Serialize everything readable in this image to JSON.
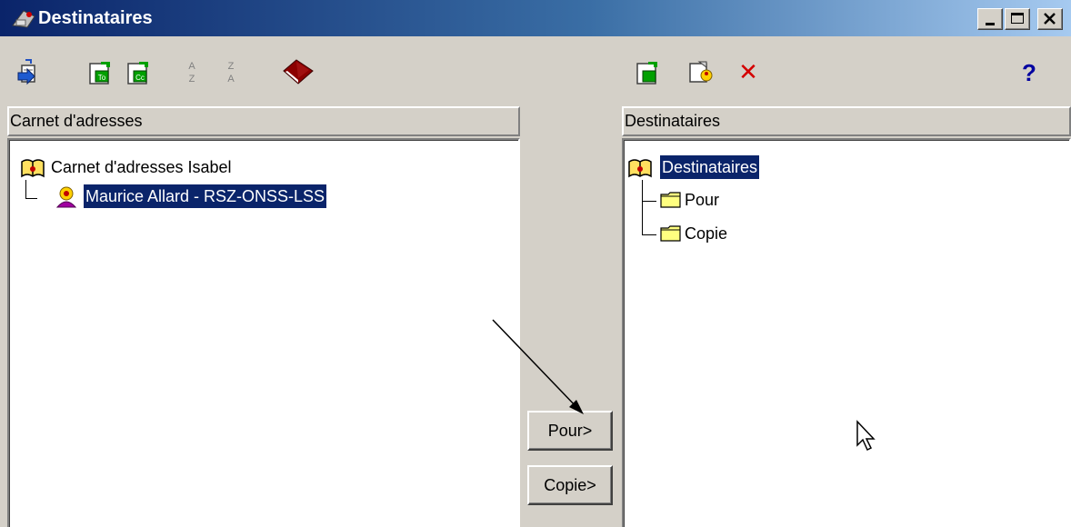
{
  "window": {
    "title": "Destinataires"
  },
  "colors": {
    "title_start": "#0a246a",
    "title_end": "#a6caf0",
    "selection": "#0a246a",
    "delete_red": "#d40000",
    "help_blue": "#0000a0"
  },
  "left_toolbar": {
    "icons": [
      "import-icon",
      "add-to-icon",
      "add-cc-icon",
      "sort-ascending-icon",
      "sort-descending-icon",
      "address-book-icon"
    ]
  },
  "right_toolbar": {
    "icons": [
      "add-recipient-icon",
      "properties-icon",
      "delete-icon",
      "help-icon"
    ],
    "help_glyph": "?",
    "delete_glyph": "✕"
  },
  "left_panel": {
    "header": "Carnet d'adresses",
    "root": "Carnet d'adresses Isabel",
    "children": [
      "Maurice Allard - RSZ-ONSS-LSS"
    ]
  },
  "right_panel": {
    "header": "Destinataires",
    "root": "Destinataires",
    "children": [
      "Pour",
      "Copie"
    ]
  },
  "buttons": {
    "to": "Pour>",
    "cc": "Copie>"
  }
}
